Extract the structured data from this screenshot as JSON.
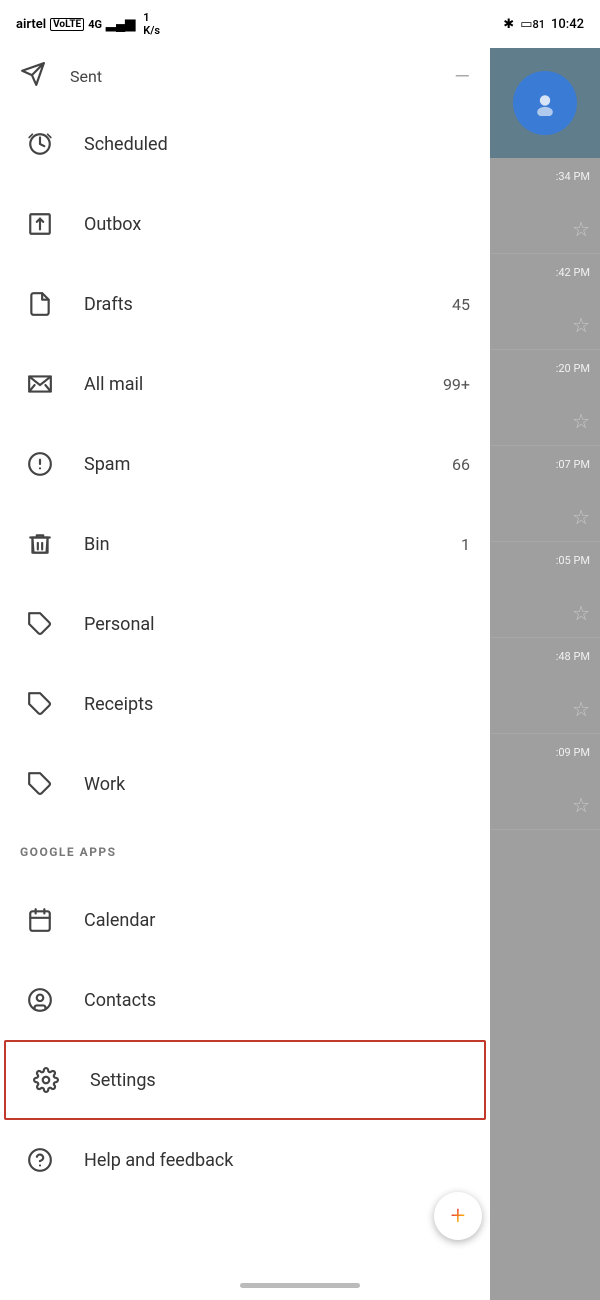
{
  "statusBar": {
    "carrier": "airtel",
    "networkType": "VoLTE 4G",
    "signalBars": "▂▄▆",
    "dataSpeed": "1 K/s",
    "bluetooth": "✱",
    "battery": "81",
    "time": "10:42"
  },
  "drawer": {
    "topItem": {
      "label": "Sent",
      "icon": "sent-icon"
    },
    "menuItems": [
      {
        "id": "scheduled",
        "label": "Scheduled",
        "icon": "scheduled-icon",
        "badge": ""
      },
      {
        "id": "outbox",
        "label": "Outbox",
        "icon": "outbox-icon",
        "badge": ""
      },
      {
        "id": "drafts",
        "label": "Drafts",
        "icon": "drafts-icon",
        "badge": "45"
      },
      {
        "id": "allmail",
        "label": "All mail",
        "icon": "allmail-icon",
        "badge": "99+"
      },
      {
        "id": "spam",
        "label": "Spam",
        "icon": "spam-icon",
        "badge": "66"
      },
      {
        "id": "bin",
        "label": "Bin",
        "icon": "bin-icon",
        "badge": "1"
      },
      {
        "id": "personal",
        "label": "Personal",
        "icon": "personal-icon",
        "badge": ""
      },
      {
        "id": "receipts",
        "label": "Receipts",
        "icon": "receipts-icon",
        "badge": ""
      },
      {
        "id": "work",
        "label": "Work",
        "icon": "work-icon",
        "badge": ""
      }
    ],
    "sectionLabel": "GOOGLE APPS",
    "googleApps": [
      {
        "id": "calendar",
        "label": "Calendar",
        "icon": "calendar-icon"
      },
      {
        "id": "contacts",
        "label": "Contacts",
        "icon": "contacts-icon"
      },
      {
        "id": "settings",
        "label": "Settings",
        "icon": "settings-icon",
        "highlighted": true
      },
      {
        "id": "help",
        "label": "Help and feedback",
        "icon": "help-icon"
      }
    ]
  },
  "emailPeek": {
    "times": [
      ":34 PM",
      ":42 PM",
      ":20 PM",
      ":07 PM",
      ":05 PM",
      ":48 PM",
      ":09 PM"
    ],
    "fabLabel": "+"
  }
}
